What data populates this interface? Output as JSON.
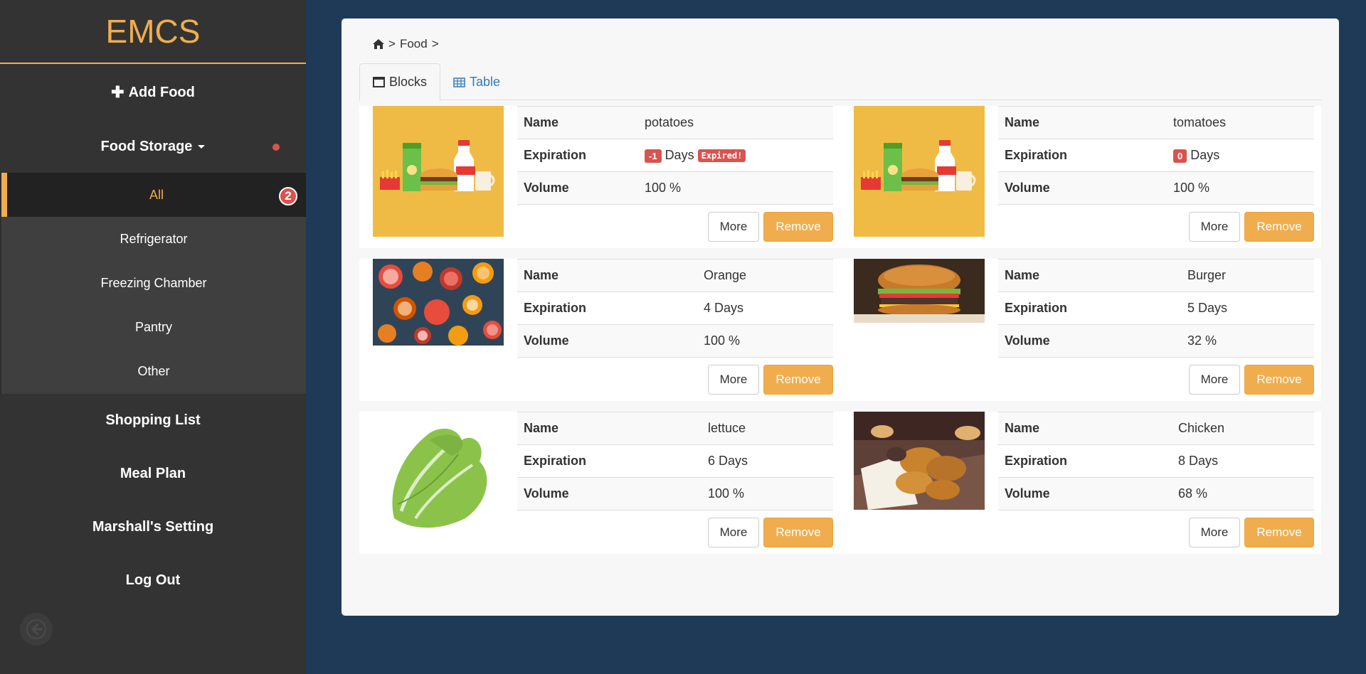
{
  "app": {
    "brand": "EMCS"
  },
  "sidebar": {
    "add_food": "Add Food",
    "food_storage": "Food Storage",
    "submenu": [
      {
        "label": "All",
        "badge": "2",
        "active": true
      },
      {
        "label": "Refrigerator"
      },
      {
        "label": "Freezing Chamber"
      },
      {
        "label": "Pantry"
      },
      {
        "label": "Other"
      }
    ],
    "shopping_list": "Shopping List",
    "meal_plan": "Meal Plan",
    "settings": "Marshall's Setting",
    "logout": "Log Out"
  },
  "breadcrumb": {
    "sep1": ">",
    "current": "Food",
    "sep2": ">"
  },
  "tabs": {
    "blocks": "Blocks",
    "table": "Table"
  },
  "labels": {
    "name": "Name",
    "expiration": "Expiration",
    "volume": "Volume",
    "more": "More",
    "remove": "Remove"
  },
  "items": [
    {
      "name": "potatoes",
      "days_value": "-1",
      "days_unit": "Days",
      "expired_label": "Expired!",
      "volume": "100 %"
    },
    {
      "name": "tomatoes",
      "days_value": "0",
      "days_unit": "Days",
      "volume": "100 %"
    },
    {
      "name": "Orange",
      "expiration": "4 Days",
      "volume": "100 %"
    },
    {
      "name": "Burger",
      "expiration": "5 Days",
      "volume": "32 %"
    },
    {
      "name": "lettuce",
      "expiration": "6 Days",
      "volume": "100 %"
    },
    {
      "name": "Chicken",
      "expiration": "8 Days",
      "volume": "68 %"
    }
  ],
  "colors": {
    "accent": "#f0ad4e",
    "danger": "#d9534f",
    "sidebar": "#333333",
    "background": "#1f3a56",
    "link": "#337ab7"
  },
  "icons": [
    "plus-icon",
    "caret-down-icon",
    "home-icon",
    "window-icon",
    "table-icon",
    "arrow-left-icon"
  ]
}
